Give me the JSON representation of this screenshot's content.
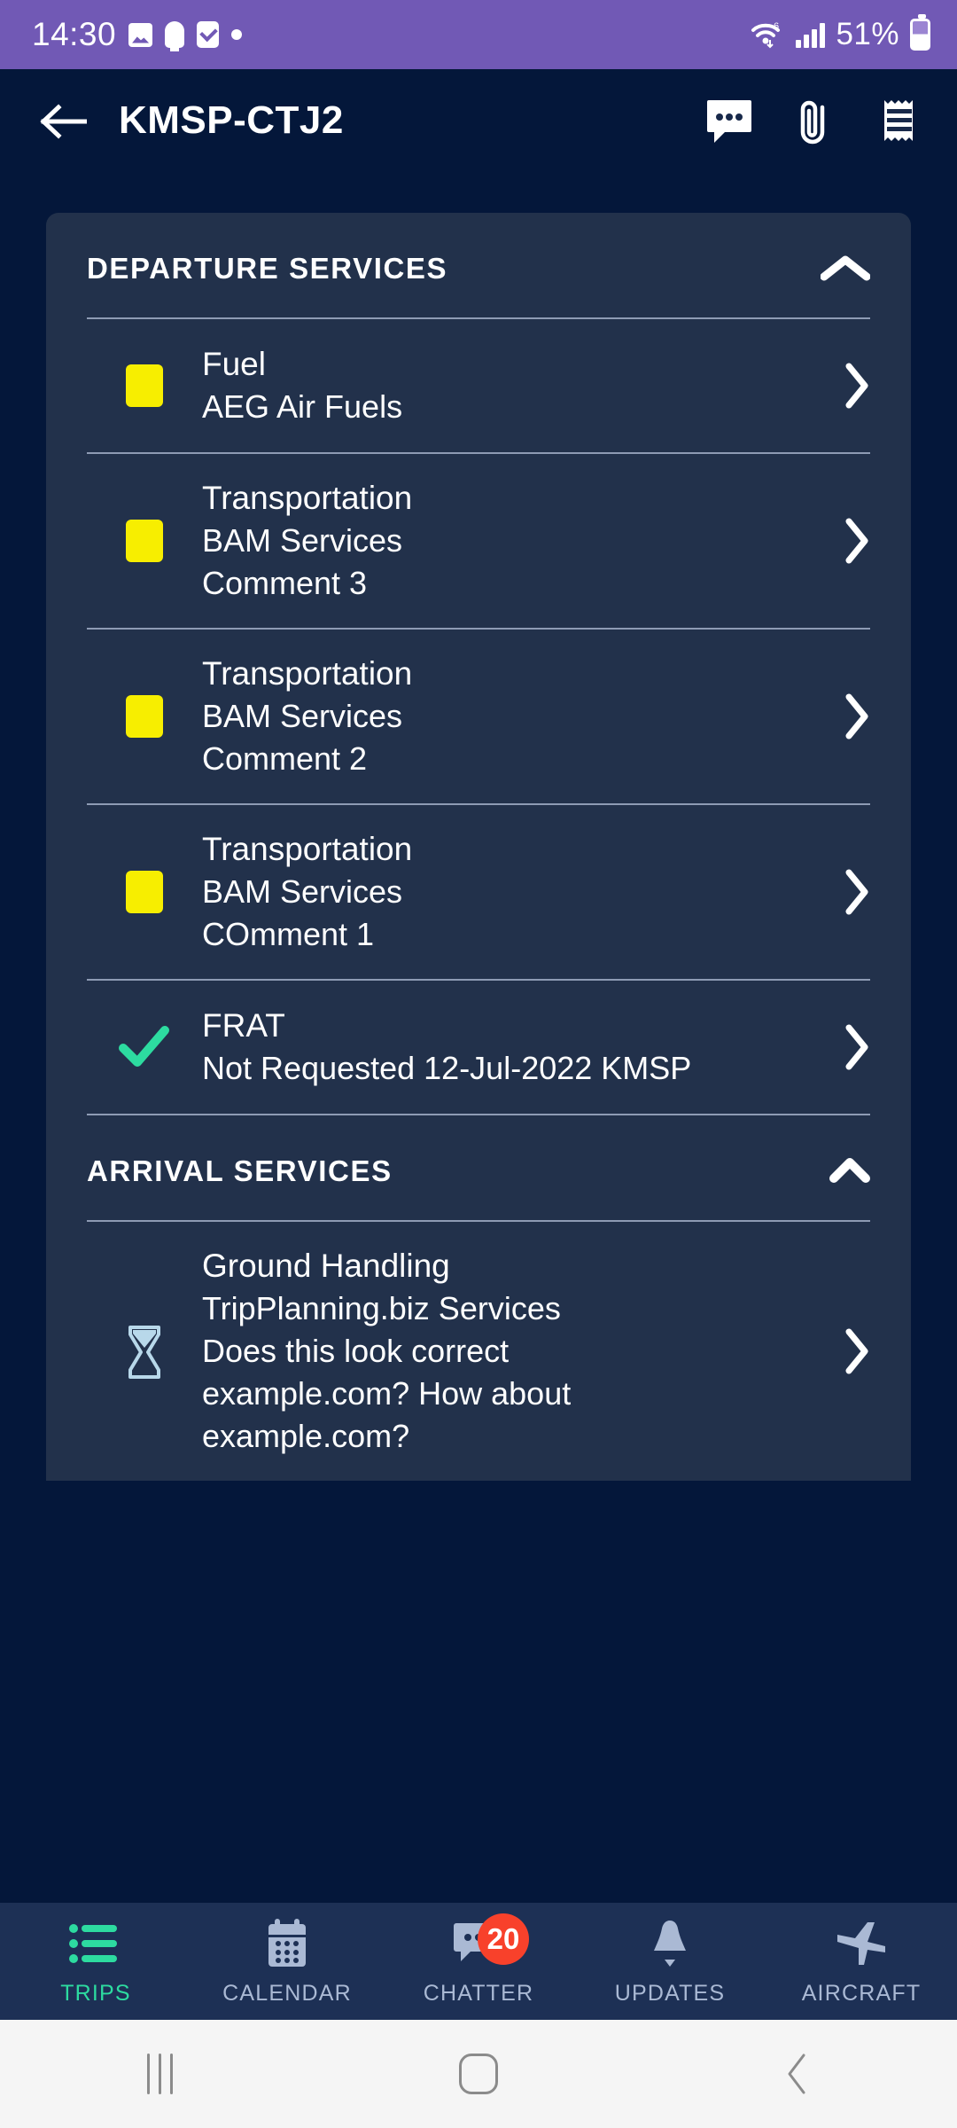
{
  "status_bar": {
    "time": "14:30",
    "battery_text": "51%",
    "icons": [
      "image-icon",
      "bulb-icon",
      "checkbox-icon",
      "dot-icon",
      "wifi-icon",
      "cellular-signal-icon",
      "battery-icon"
    ],
    "background_color": "#7159b5"
  },
  "app_bar": {
    "back_label": "←",
    "title": "KMSP-CTJ2",
    "actions": [
      "chat-bubble-icon",
      "paperclip-icon",
      "receipt-icon"
    ]
  },
  "colors": {
    "page_background": "#04173a",
    "card_background": "#22314b",
    "nav_background": "#1d3055",
    "accent_green": "#2ddba0",
    "status_yellow": "#f7ee00",
    "status_hourglass": "#b8d8ea",
    "badge_red": "#f8412b",
    "divider": "#8e9bb4"
  },
  "sections": [
    {
      "title": "DEPARTURE SERVICES",
      "collapse_icon": "chevron-up-icon",
      "expanded": true,
      "rows": [
        {
          "status_icon": "yellow-square-icon",
          "lines": [
            "Fuel",
            "AEG Air Fuels"
          ],
          "chevron": "chevron-right-icon"
        },
        {
          "status_icon": "yellow-square-icon",
          "lines": [
            "Transportation",
            "BAM Services",
            "Comment 3"
          ],
          "chevron": "chevron-right-icon"
        },
        {
          "status_icon": "yellow-square-icon",
          "lines": [
            "Transportation",
            "BAM Services",
            "Comment 2"
          ],
          "chevron": "chevron-right-icon"
        },
        {
          "status_icon": "yellow-square-icon",
          "lines": [
            "Transportation",
            "BAM Services",
            "COmment 1"
          ],
          "chevron": "chevron-right-icon"
        },
        {
          "status_icon": "green-check-icon",
          "lines": [
            "FRAT",
            "Not Requested 12-Jul-2022 KMSP"
          ],
          "chevron": "chevron-right-icon"
        }
      ]
    },
    {
      "title": "ARRIVAL SERVICES",
      "collapse_icon": "chevron-up-icon",
      "expanded": true,
      "rows": [
        {
          "status_icon": "hourglass-icon",
          "lines": [
            "Ground Handling",
            "TripPlanning.biz Services",
            "Does this look correct example.com?  How about example.com?"
          ],
          "chevron": "chevron-right-icon"
        }
      ]
    }
  ],
  "bottom_nav": {
    "items": [
      {
        "label": "TRIPS",
        "icon": "list-icon",
        "active": true
      },
      {
        "label": "CALENDAR",
        "icon": "calendar-icon",
        "active": false
      },
      {
        "label": "CHATTER",
        "icon": "chat-bubble-icon",
        "active": false,
        "badge": "20"
      },
      {
        "label": "UPDATES",
        "icon": "bell-icon",
        "active": false
      },
      {
        "label": "AIRCRAFT",
        "icon": "airplane-icon",
        "active": false
      }
    ]
  },
  "system_nav": {
    "items": [
      "recents-icon",
      "home-icon",
      "back-icon"
    ]
  }
}
